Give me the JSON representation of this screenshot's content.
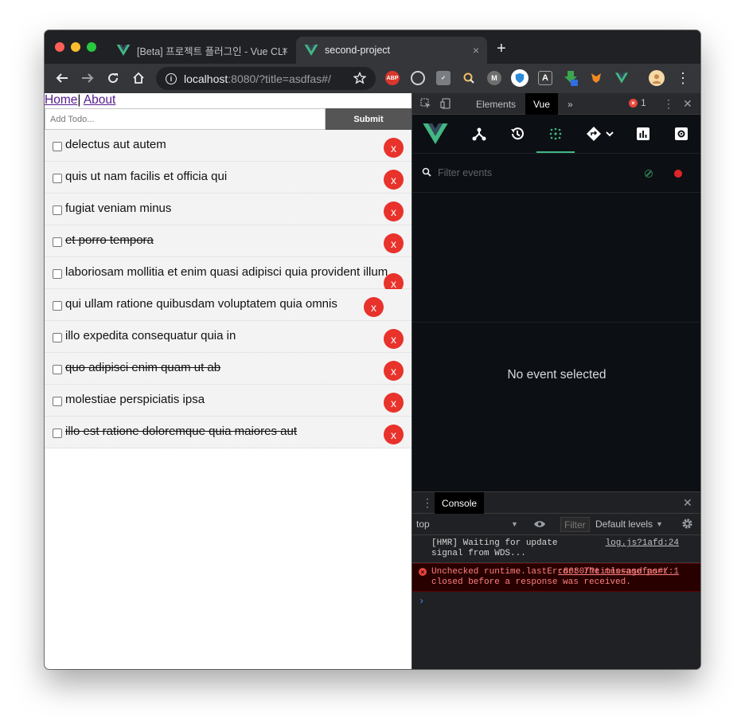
{
  "browser": {
    "tabs": [
      {
        "title": "[Beta] 프로젝트 플러그인 - Vue CLI",
        "close": "×"
      },
      {
        "title": "second-project",
        "close": "×"
      }
    ],
    "new_tab": "+",
    "url_host": "localhost",
    "url_rest": ":8080/?title=asdfas#/",
    "extensions": [
      "ABP",
      "LastPass",
      "Checkmark",
      "Search",
      "M",
      "Shield",
      "Font",
      "Download",
      "Metamask",
      "Vue",
      "Avatar"
    ]
  },
  "app": {
    "nav": {
      "home": "Home",
      "separator": "|",
      "about": "About"
    },
    "add_placeholder": "Add Todo...",
    "submit_label": "Submit",
    "delete_label": "x",
    "todos": [
      {
        "text": "delectus aut autem",
        "done": false
      },
      {
        "text": "quis ut nam facilis et officia qui",
        "done": false
      },
      {
        "text": "fugiat veniam minus",
        "done": false
      },
      {
        "text": "et porro tempora",
        "done": true
      },
      {
        "text": "laboriosam mollitia et enim quasi adipisci quia provident illum",
        "done": false
      },
      {
        "text": "qui ullam ratione quibusdam voluptatem quia omnis",
        "done": false
      },
      {
        "text": "illo expedita consequatur quia in",
        "done": false
      },
      {
        "text": "quo adipisci enim quam ut ab",
        "done": true
      },
      {
        "text": "molestiae perspiciatis ipsa",
        "done": false
      },
      {
        "text": "illo est ratione doloremque quia maiores aut",
        "done": true
      }
    ]
  },
  "devtools": {
    "tabs": {
      "elements": "Elements",
      "vue": "Vue",
      "more": "»"
    },
    "error_count": "1",
    "filter_placeholder": "Filter events",
    "no_event": "No event selected",
    "console": {
      "tab": "Console",
      "context": "top",
      "filter": "Filter",
      "levels": "Default levels",
      "messages": [
        {
          "type": "log",
          "text": "[HMR] Waiting for update signal from WDS...",
          "source": "log.js?1afd:24"
        },
        {
          "type": "error",
          "text": "Unchecked runtime.lastError: The message port closed before a response was received.",
          "source": ":8080/?title=asdfas#/:1"
        }
      ],
      "prompt": "›"
    }
  }
}
